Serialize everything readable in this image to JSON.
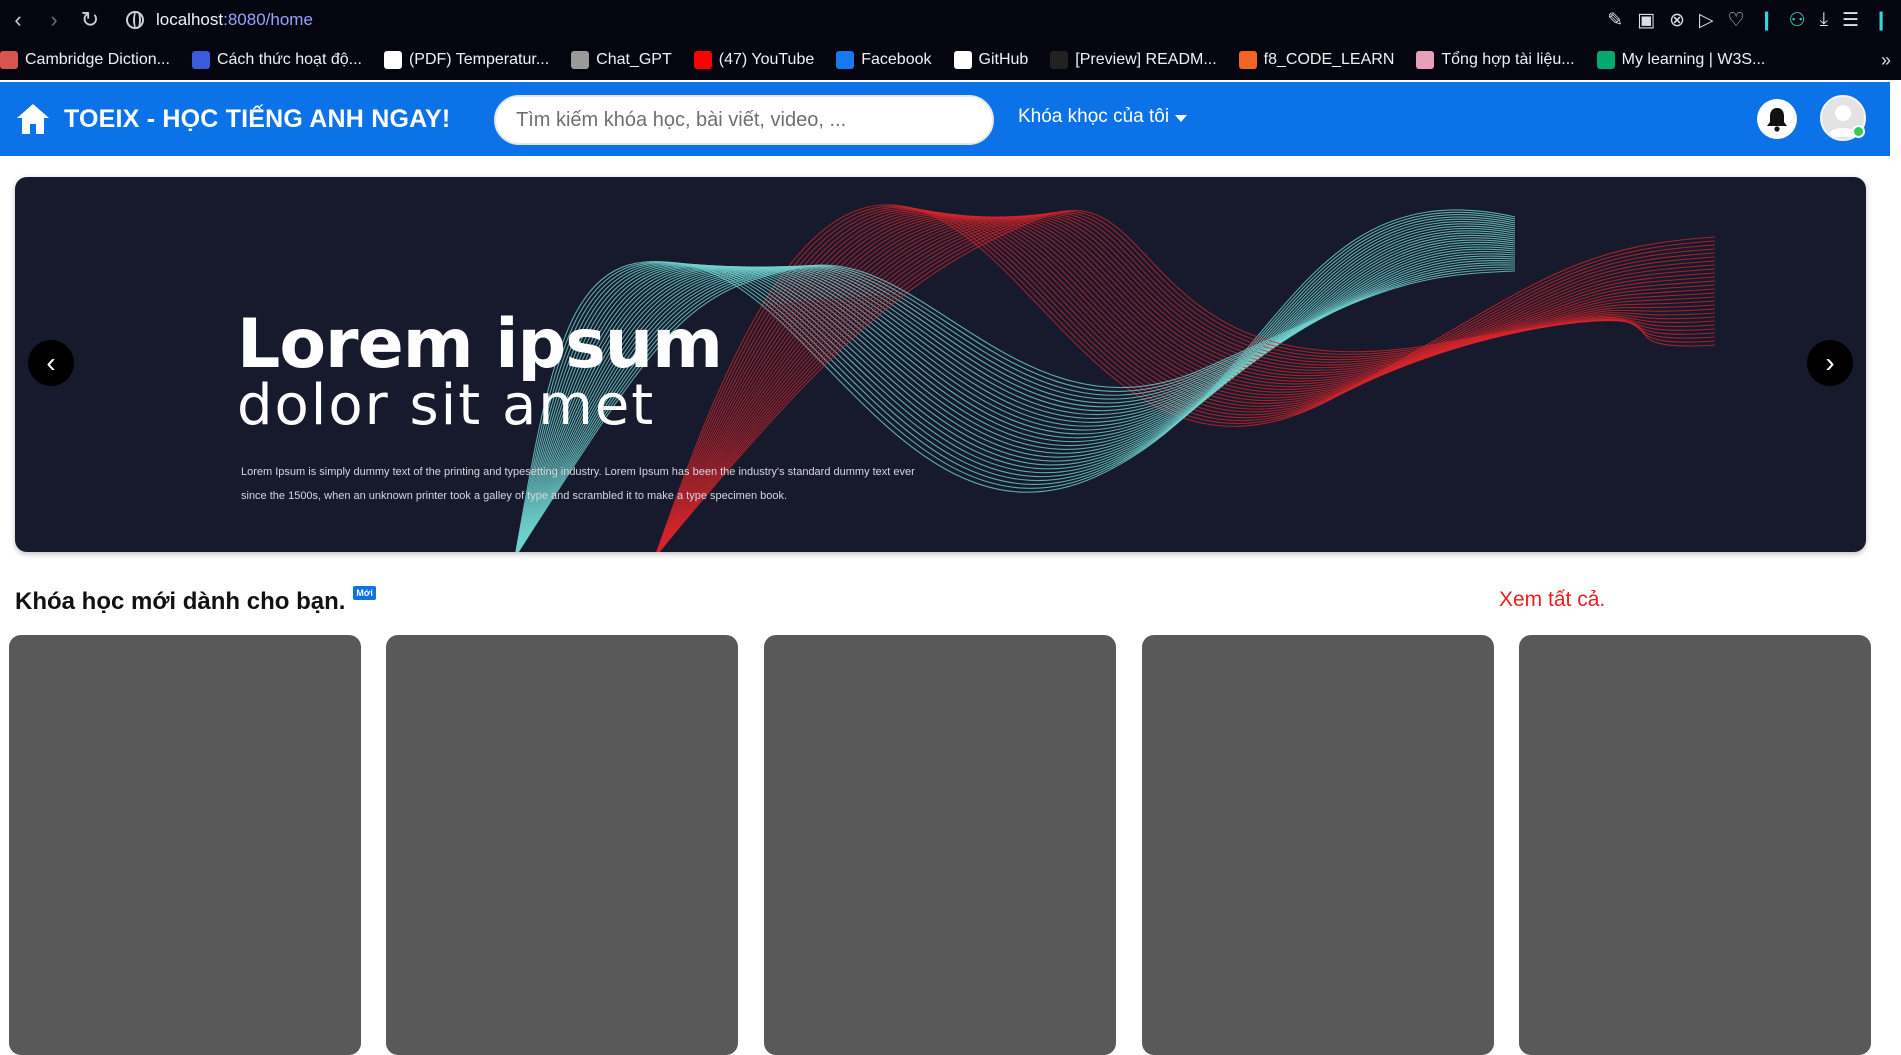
{
  "browser": {
    "url_host": "localhost",
    "url_rest": ":8080/home",
    "icons": [
      "back-icon",
      "forward-icon",
      "reload-icon",
      "site-info-icon",
      "edit-icon",
      "camera-icon",
      "shield-icon",
      "send-icon",
      "heart-icon",
      "profile-icon",
      "download-icon",
      "menu-icon"
    ]
  },
  "bookmarks": [
    {
      "label": "Cambridge Diction...",
      "color": "#d9534f"
    },
    {
      "label": "Cách thức hoạt độ...",
      "color": "#3b5bdb"
    },
    {
      "label": "(PDF) Temperatur...",
      "color": "#ffffff"
    },
    {
      "label": "Chat_GPT",
      "color": "#9a9a9a"
    },
    {
      "label": "(47) YouTube",
      "color": "#ff0000"
    },
    {
      "label": "Facebook",
      "color": "#1877f2"
    },
    {
      "label": "GitHub",
      "color": "#ffffff"
    },
    {
      "label": "[Preview] READM...",
      "color": "#222222"
    },
    {
      "label": "f8_CODE_LEARN",
      "color": "#f26522"
    },
    {
      "label": "Tổng hợp tài liệu...",
      "color": "#e8a0b8"
    },
    {
      "label": "My learning | W3S...",
      "color": "#04aa6d"
    }
  ],
  "header": {
    "brand": "TOEIX - HỌC TIẾNG ANH NGAY!",
    "search_placeholder": "Tìm kiếm khóa học, bài viết, video, ...",
    "courses_menu": "Khóa khọc của tôi",
    "accent_color": "#0b72e7"
  },
  "banner": {
    "title": "Lorem ipsum",
    "subtitle": "dolor sit amet",
    "text": "Lorem Ipsum is simply dummy text of the printing and typesetting industry. Lorem Ipsum has been the industry's standard dummy text ever since the 1500s, when an unknown printer took a galley of type and scrambled it to make a type specimen book.",
    "prev_label": "‹",
    "next_label": "›"
  },
  "section": {
    "title": "Khóa học mới dành cho bạn.",
    "badge": "Mới",
    "see_all": "Xem tất cả."
  }
}
